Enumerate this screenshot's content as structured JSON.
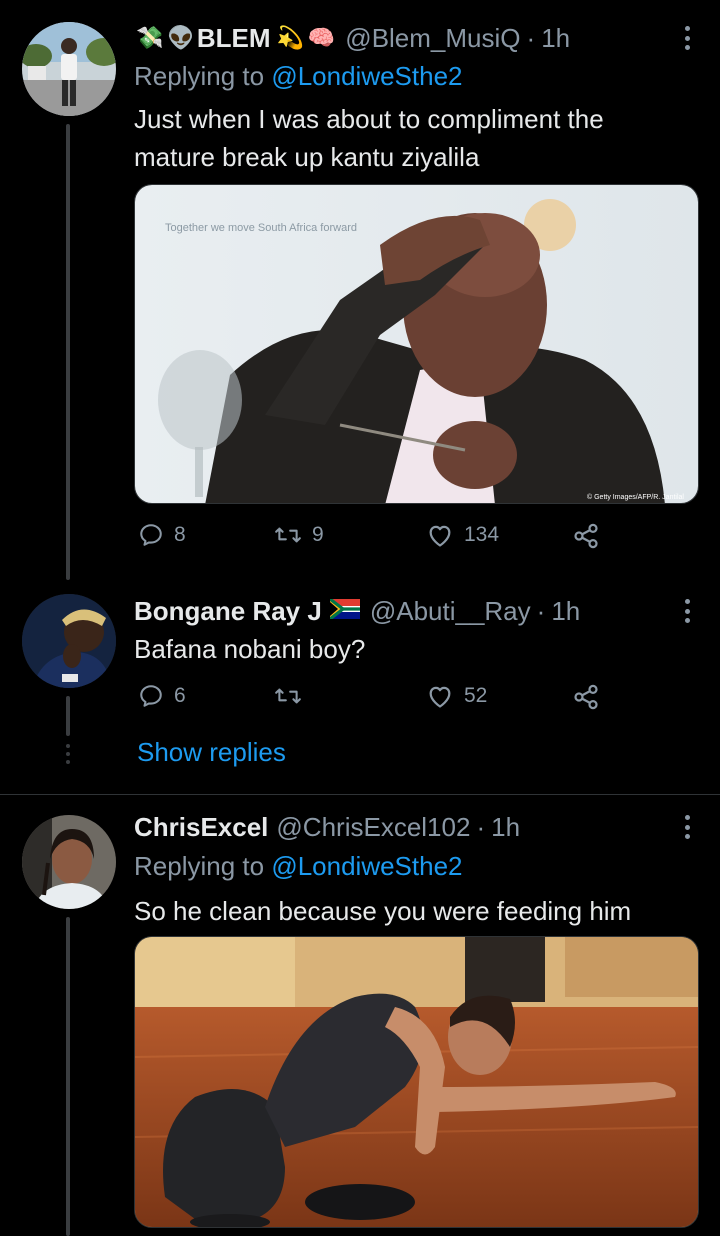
{
  "tweets": [
    {
      "name": "BLEM",
      "name_prefix_emoji": [
        "💸",
        "👽"
      ],
      "name_suffix_emoji": [
        "💫",
        "🧠"
      ],
      "handle": "@Blem_MusiQ",
      "time": "1h",
      "replying_to_label": "Replying to",
      "replying_to_handle": "@LondiweSthe2",
      "text": "Just when I was about to compliment the mature break up kantu ziyalila",
      "image": {
        "description_icon": "photo-man-hand-on-forehead",
        "banner_text": "Together we move South Africa forward",
        "credit": "© Getty Images/AFP/R. Jantilal"
      },
      "stats": {
        "replies": "8",
        "retweets": "9",
        "likes": "134"
      }
    },
    {
      "name": "Bongane Ray J",
      "name_suffix_emoji": [
        "🇿🇦"
      ],
      "handle": "@Abuti__Ray",
      "time": "1h",
      "text": "Bafana nobani boy?",
      "stats": {
        "replies": "6",
        "retweets": "",
        "likes": "52"
      }
    },
    {
      "name": "ChrisExcel",
      "handle": "@ChrisExcel102",
      "time": "1h",
      "replying_to_label": "Replying to",
      "replying_to_handle": "@LondiweSthe2",
      "text": "So he clean because you were feeding him",
      "image": {
        "description_icon": "photo-woman-on-floor"
      }
    }
  ],
  "thread": {
    "show_replies_label": "Show replies"
  },
  "colors": {
    "background": "#000000",
    "text": "#e7e9ea",
    "secondary": "#8b98a5",
    "link": "#1d9bf0",
    "divider": "#2f3336"
  }
}
